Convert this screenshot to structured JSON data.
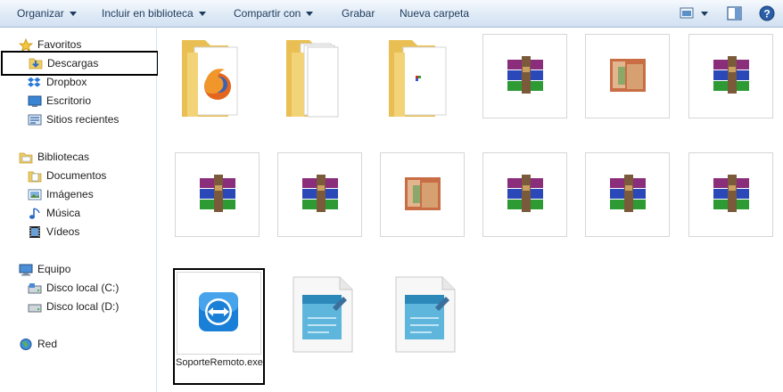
{
  "toolbar": {
    "organize": "Organizar",
    "include_library": "Incluir en biblioteca",
    "share_with": "Compartir con",
    "burn": "Grabar",
    "new_folder": "Nueva carpeta",
    "view_icon": "view-options-icon",
    "preview_icon": "preview-pane-icon",
    "help_icon": "help-icon"
  },
  "sidebar": {
    "favorites": "Favoritos",
    "downloads": "Descargas",
    "dropbox": "Dropbox",
    "desktop": "Escritorio",
    "recent": "Sitios recientes",
    "libraries": "Bibliotecas",
    "documents": "Documentos",
    "images": "Imágenes",
    "music": "Música",
    "videos": "Vídeos",
    "computer": "Equipo",
    "disk_c": "Disco local (C:)",
    "disk_d": "Disco local (D:)",
    "network": "Red"
  },
  "files": {
    "selected_name": "SoporteRemoto.exe"
  },
  "colors": {
    "toolbar_bg": "#dde9f6",
    "folder_yellow": "#f2cf6a",
    "selection_border": "#000000"
  }
}
